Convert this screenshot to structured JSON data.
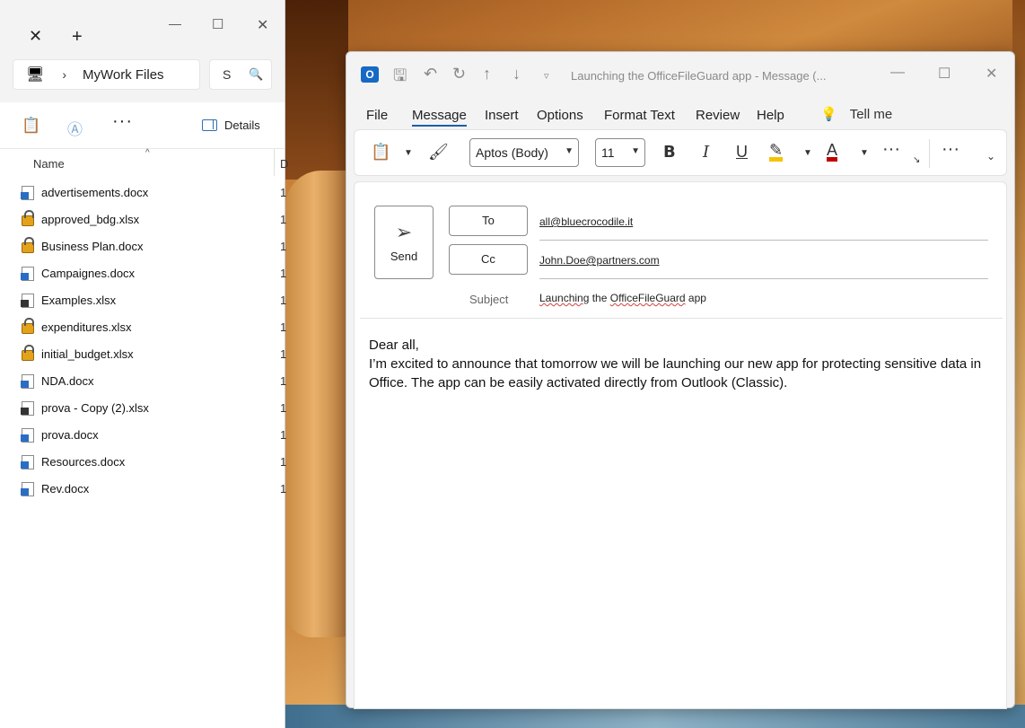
{
  "explorer": {
    "address": "MyWork Files",
    "search_placeholder": "S",
    "details_label": "Details",
    "column_name": "Name",
    "column_d": "D",
    "files": [
      {
        "name": "advertisements.docx",
        "icon": "word-shared-icon",
        "d": "1"
      },
      {
        "name": "approved_bdg.xlsx",
        "icon": "lock-icon",
        "d": "1"
      },
      {
        "name": "Business Plan.docx",
        "icon": "lock-icon",
        "d": "1"
      },
      {
        "name": "Campaignes.docx",
        "icon": "word-shared-icon",
        "d": "1"
      },
      {
        "name": "Examples.xlsx",
        "icon": "excel-shared-icon",
        "d": "1"
      },
      {
        "name": "expenditures.xlsx",
        "icon": "lock-icon",
        "d": "1"
      },
      {
        "name": "initial_budget.xlsx",
        "icon": "lock-icon",
        "d": "1"
      },
      {
        "name": "NDA.docx",
        "icon": "word-shared-icon",
        "d": "1"
      },
      {
        "name": "prova - Copy (2).xlsx",
        "icon": "excel-shared-icon",
        "d": "1"
      },
      {
        "name": "prova.docx",
        "icon": "word-shared-icon",
        "d": "1"
      },
      {
        "name": "Resources.docx",
        "icon": "word-shared-icon",
        "d": "1"
      },
      {
        "name": "Rev.docx",
        "icon": "word-shared-icon",
        "d": "1"
      }
    ]
  },
  "outlook": {
    "window_title": "Launching the OfficeFileGuard app  -  Message (...",
    "menu": [
      "File",
      "Message",
      "Insert",
      "Options",
      "Format Text",
      "Review",
      "Help"
    ],
    "active_menu": "Message",
    "tell_me": "Tell me",
    "font_name": "Aptos (Body)",
    "font_size": "11",
    "send_label": "Send",
    "to_label": "To",
    "cc_label": "Cc",
    "to_value": "all@bluecrocodile.it",
    "cc_value": "John.Doe@partners.com",
    "subject_label": "Subject",
    "subject_parts": [
      "Launching",
      " the ",
      "OfficeFileGuard",
      " app"
    ],
    "body_greeting": "Dear all,",
    "body_text": "I’m excited to announce that tomorrow we will be launching our new app for protecting sensitive data in Office. The app can be easily activated directly from Outlook (Classic).",
    "colors": {
      "highlight": "#f5c400",
      "font_color": "#c00000",
      "accent": "#1b5fa8"
    }
  }
}
